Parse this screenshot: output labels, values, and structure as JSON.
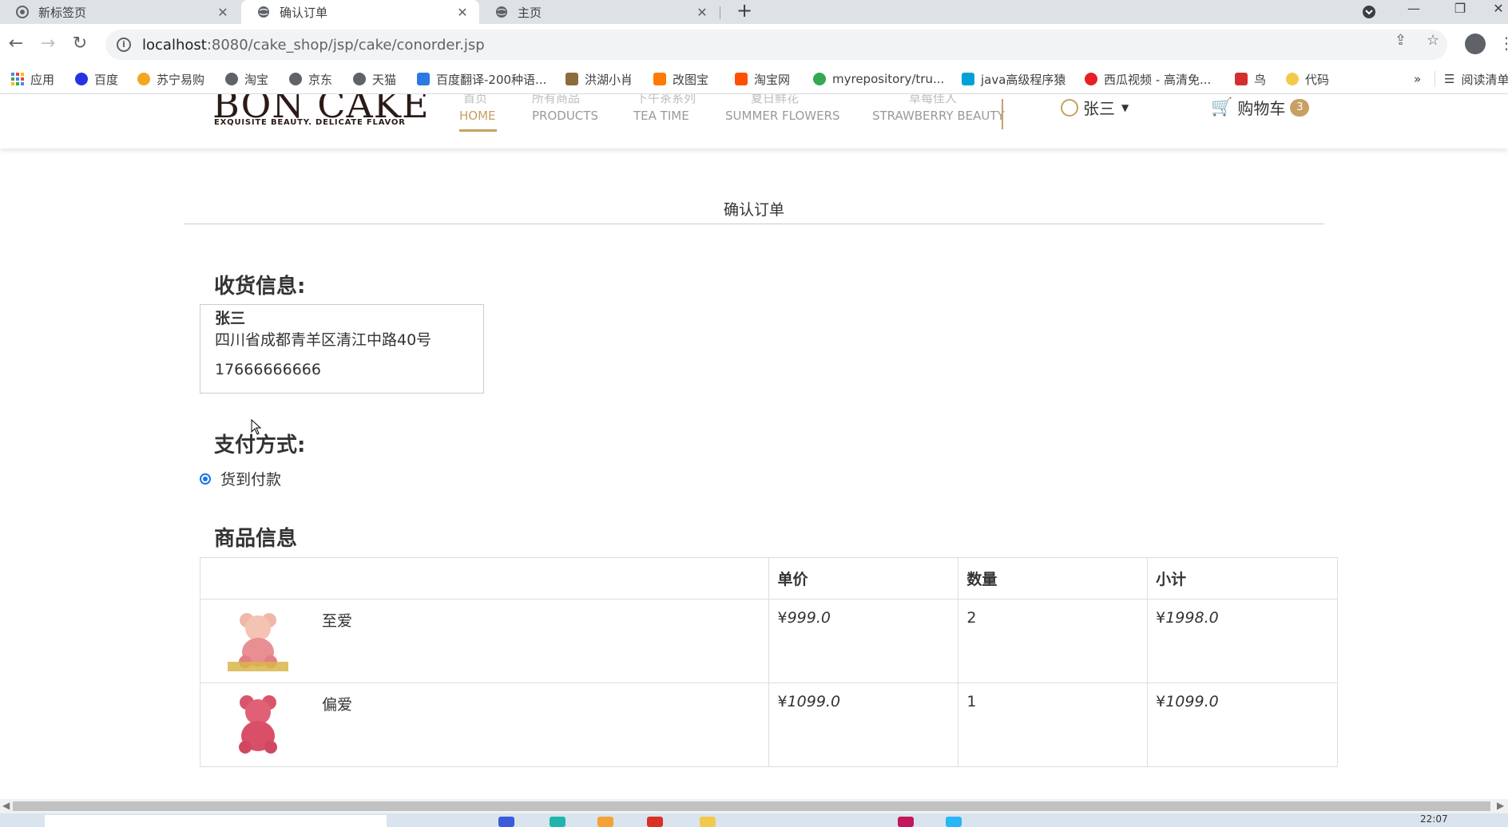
{
  "browser": {
    "tabs": [
      {
        "title": "新标签页",
        "active": false
      },
      {
        "title": "确认订单",
        "active": true
      },
      {
        "title": "主页",
        "active": false
      }
    ],
    "url_host": "localhost",
    "url_rest": ":8080/cake_shop/jsp/cake/conorder.jsp",
    "bookmarks": [
      {
        "label": "应用",
        "color": "#4285f4"
      },
      {
        "label": "百度",
        "color": "#2932e1"
      },
      {
        "label": "苏宁易购",
        "color": "#f5a623"
      },
      {
        "label": "淘宝",
        "color": "#5f6368"
      },
      {
        "label": "京东",
        "color": "#5f6368"
      },
      {
        "label": "天猫",
        "color": "#5f6368"
      },
      {
        "label": "百度翻译-200种语...",
        "color": "#2a7ae2"
      },
      {
        "label": "洪湖小肖",
        "color": "#8a6d3b"
      },
      {
        "label": "改图宝",
        "color": "#ff7a00"
      },
      {
        "label": "淘宝网",
        "color": "#ff5000"
      },
      {
        "label": "myrepository/tru...",
        "color": "#34a853"
      },
      {
        "label": "java高级程序猿",
        "color": "#00a1d6"
      },
      {
        "label": "西瓜视频 - 高清免...",
        "color": "#e81e25"
      },
      {
        "label": "鸟",
        "color": "#d32f2f"
      },
      {
        "label": "代码",
        "color": "#f2c94c"
      }
    ],
    "bookmarks_more": "»",
    "reading_list": "阅读清单"
  },
  "site": {
    "logo": "BON CAKE",
    "logo_tagline": "EXQUISITE BEAUTY. DELICATE FLAVOR",
    "nav": [
      "HOME",
      "PRODUCTS",
      "TEA TIME",
      "SUMMER FLOWERS",
      "STRAWBERRY BEAUTY"
    ],
    "user_name": "张三",
    "cart_label": "购物车",
    "cart_count": "3",
    "accent": "#c8a064"
  },
  "page": {
    "title": "确认订单",
    "shipping_heading": "收货信息:",
    "receiver_name": "张三",
    "receiver_address": "四川省成都青羊区清江中路40号",
    "receiver_phone": "17666666666",
    "payment_heading": "支付方式:",
    "payment_option": "货到付款",
    "goods_heading": "商品信息",
    "table_headers": [
      "",
      "单价",
      "数量",
      "小计"
    ],
    "items": [
      {
        "name": "至爱",
        "price": "999.0",
        "qty": "2",
        "subtotal": "1998.0"
      },
      {
        "name": "偏爱",
        "price": "1099.0",
        "qty": "1",
        "subtotal": "1099.0"
      }
    ],
    "currency": "¥",
    "subtotal_color": "#e4393c"
  },
  "taskbar": {
    "clock": "22:07"
  }
}
